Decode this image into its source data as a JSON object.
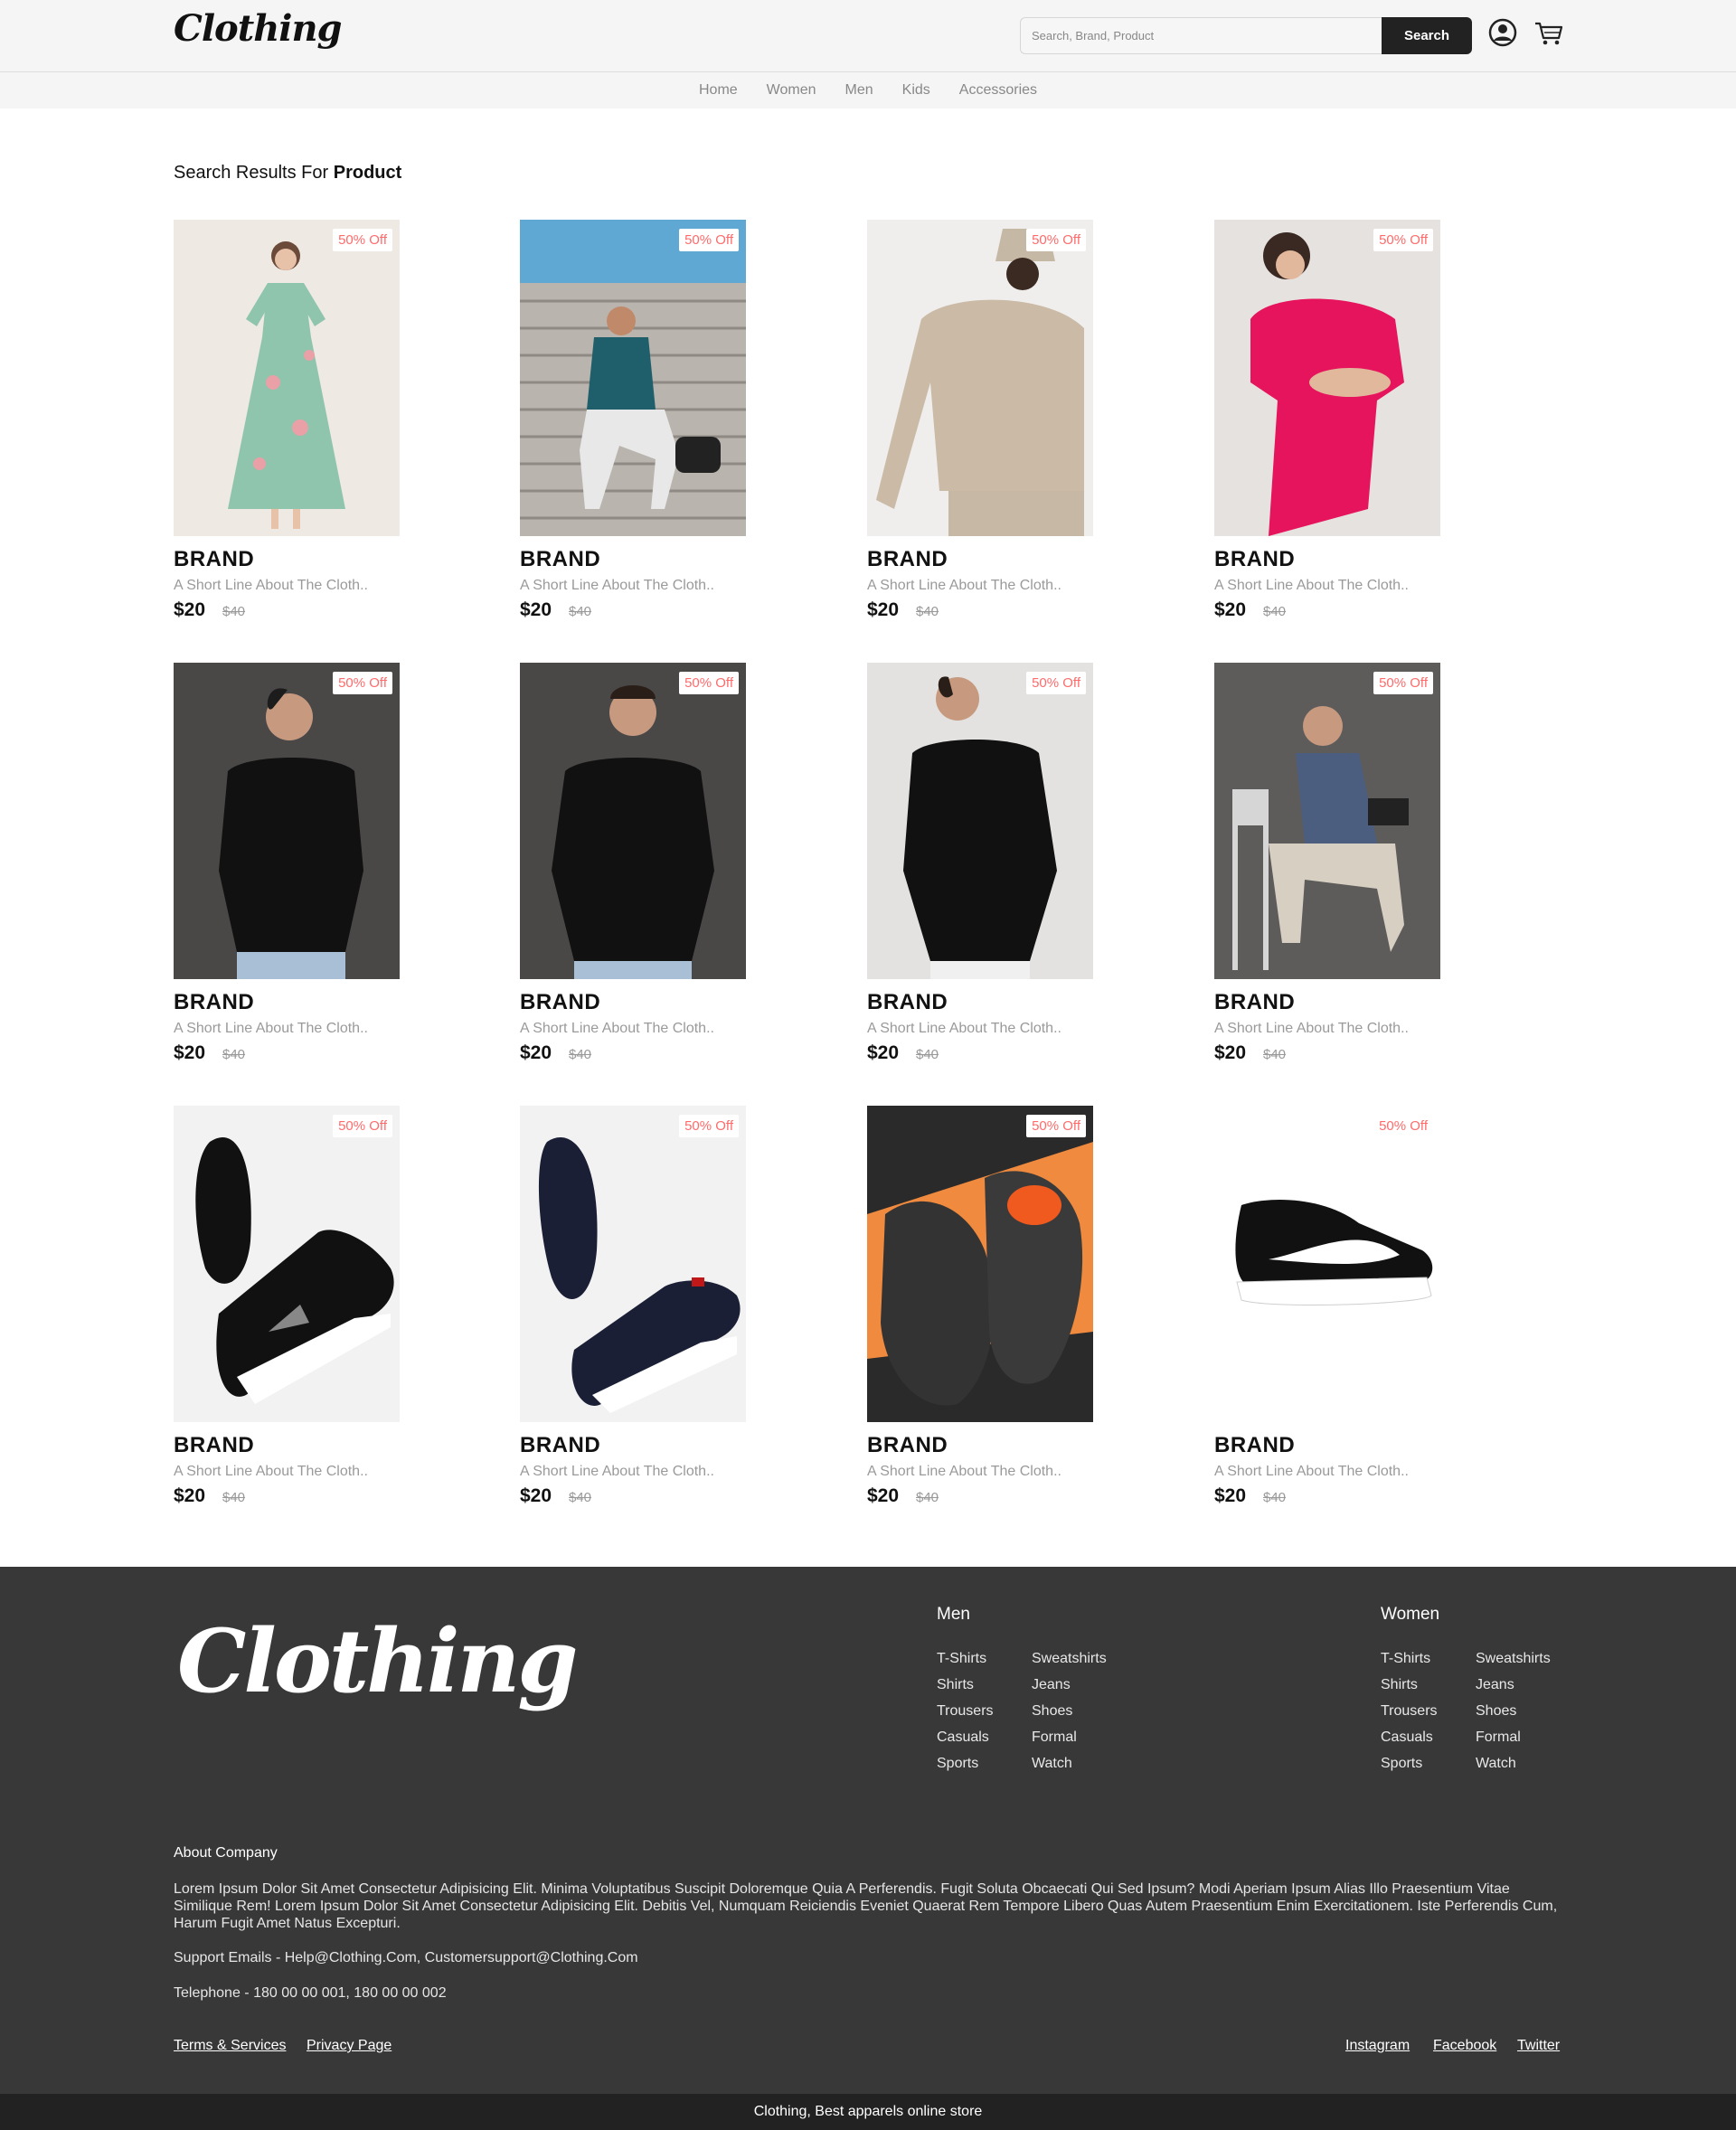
{
  "header": {
    "logo": "Clothing",
    "search_placeholder": "Search, Brand, Product",
    "search_button": "Search",
    "user_icon": "user-icon",
    "cart_icon": "cart-icon"
  },
  "nav": {
    "items": [
      "Home",
      "Women",
      "Men",
      "Kids",
      "Accessories"
    ]
  },
  "results": {
    "prefix": "Search Results For",
    "query": "Product"
  },
  "products": [
    {
      "brand": "BRAND",
      "desc": "A Short Line About The Cloth..",
      "price": "$20",
      "old_price": "$40",
      "badge": "50% Off"
    },
    {
      "brand": "BRAND",
      "desc": "A Short Line About The Cloth..",
      "price": "$20",
      "old_price": "$40",
      "badge": "50% Off"
    },
    {
      "brand": "BRAND",
      "desc": "A Short Line About The Cloth..",
      "price": "$20",
      "old_price": "$40",
      "badge": "50% Off"
    },
    {
      "brand": "BRAND",
      "desc": "A Short Line About The Cloth..",
      "price": "$20",
      "old_price": "$40",
      "badge": "50% Off"
    },
    {
      "brand": "BRAND",
      "desc": "A Short Line About The Cloth..",
      "price": "$20",
      "old_price": "$40",
      "badge": "50% Off"
    },
    {
      "brand": "BRAND",
      "desc": "A Short Line About The Cloth..",
      "price": "$20",
      "old_price": "$40",
      "badge": "50% Off"
    },
    {
      "brand": "BRAND",
      "desc": "A Short Line About The Cloth..",
      "price": "$20",
      "old_price": "$40",
      "badge": "50% Off"
    },
    {
      "brand": "BRAND",
      "desc": "A Short Line About The Cloth..",
      "price": "$20",
      "old_price": "$40",
      "badge": "50% Off"
    },
    {
      "brand": "BRAND",
      "desc": "A Short Line About The Cloth..",
      "price": "$20",
      "old_price": "$40",
      "badge": "50% Off"
    },
    {
      "brand": "BRAND",
      "desc": "A Short Line About The Cloth..",
      "price": "$20",
      "old_price": "$40",
      "badge": "50% Off"
    },
    {
      "brand": "BRAND",
      "desc": "A Short Line About The Cloth..",
      "price": "$20",
      "old_price": "$40",
      "badge": "50% Off"
    },
    {
      "brand": "BRAND",
      "desc": "A Short Line About The Cloth..",
      "price": "$20",
      "old_price": "$40",
      "badge": "50% Off"
    }
  ],
  "footer": {
    "logo": "Clothing",
    "men": {
      "title": "Men",
      "col1": [
        "T-Shirts",
        "Shirts",
        "Trousers",
        "Casuals",
        "Sports"
      ],
      "col2": [
        "Sweatshirts",
        "Jeans",
        "Shoes",
        "Formal",
        "Watch"
      ]
    },
    "women": {
      "title": "Women",
      "col1": [
        "T-Shirts",
        "Shirts",
        "Trousers",
        "Casuals",
        "Sports"
      ],
      "col2": [
        "Sweatshirts",
        "Jeans",
        "Shoes",
        "Formal",
        "Watch"
      ]
    },
    "about_title": "About Company",
    "about_text": "Lorem Ipsum Dolor Sit Amet Consectetur Adipisicing Elit. Minima Voluptatibus Suscipit Doloremque Quia A Perferendis. Fugit Soluta Obcaecati Qui Sed Ipsum? Modi Aperiam Ipsum Alias Illo Praesentium Vitae Similique Rem! Lorem Ipsum Dolor Sit Amet Consectetur Adipisicing Elit. Debitis Vel, Numquam Reiciendis Eveniet Quaerat Rem Tempore Libero Quas Autem Praesentium Enim Exercitationem. Iste Perferendis Cum, Harum Fugit Amet Natus Excepturi.",
    "support": "Support Emails - Help@Clothing.Com, Customersupport@Clothing.Com",
    "telephone": "Telephone - 180 00 00 001, 180 00 00 002",
    "links_left": [
      "Terms & Services",
      "Privacy Page"
    ],
    "links_right": [
      "Instagram",
      "Facebook",
      "Twitter"
    ],
    "tagline": "Clothing, Best apparels online store"
  }
}
